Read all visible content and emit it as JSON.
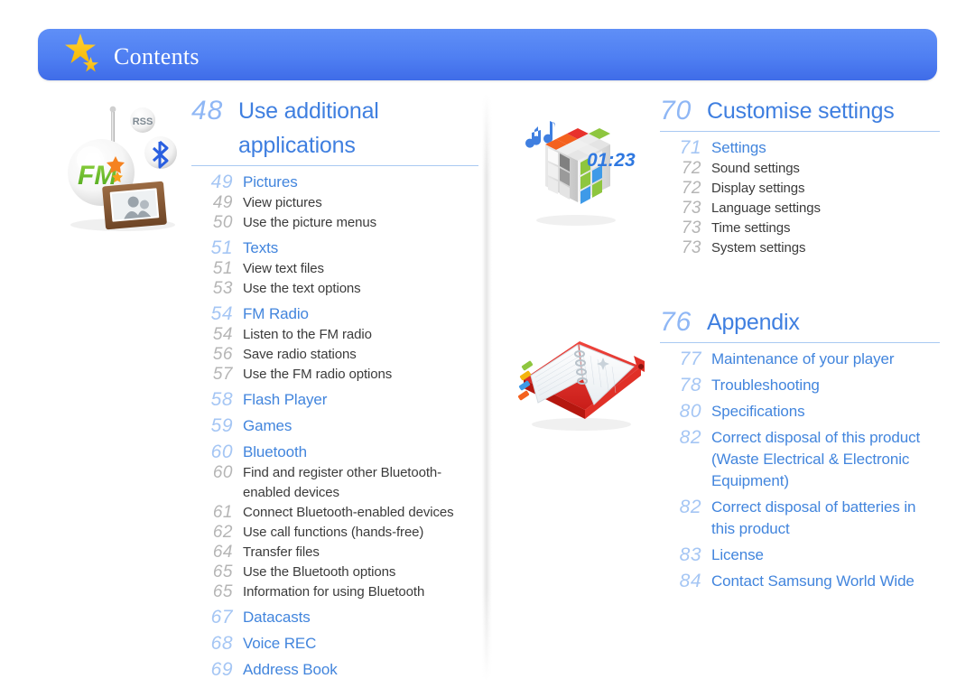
{
  "header": {
    "title": "Contents",
    "icon": "star-icon",
    "banner_color_top": "#5f8ff7",
    "banner_color_bottom": "#3f6ce8",
    "star_color": "#ffd23a"
  },
  "theme": {
    "major_text": "#4285dd",
    "major_number": "#a5c6f4",
    "sub_text": "#3b3b3b",
    "sub_number": "#b5b5b5",
    "section_title": "#3f7fe0",
    "section_number": "#8fb7f5",
    "rule": "#a9c9f2"
  },
  "left_column": {
    "illustration": {
      "name": "fm-radio-illustration",
      "fm_label": "FM",
      "rss_label": "RSS",
      "bluetooth_label": "bluetooth-icon"
    },
    "section": {
      "number": "48",
      "title": "Use additional applications"
    },
    "entries": [
      {
        "level": 1,
        "number": "49",
        "label": "Pictures"
      },
      {
        "level": 2,
        "number": "49",
        "label": "View pictures"
      },
      {
        "level": 2,
        "number": "50",
        "label": "Use the picture menus"
      },
      {
        "level": 1,
        "number": "51",
        "label": "Texts"
      },
      {
        "level": 2,
        "number": "51",
        "label": "View text files"
      },
      {
        "level": 2,
        "number": "53",
        "label": "Use the text options"
      },
      {
        "level": 1,
        "number": "54",
        "label": "FM Radio"
      },
      {
        "level": 2,
        "number": "54",
        "label": "Listen to the FM radio"
      },
      {
        "level": 2,
        "number": "56",
        "label": "Save radio stations"
      },
      {
        "level": 2,
        "number": "57",
        "label": "Use the FM radio options"
      },
      {
        "level": 1,
        "number": "58",
        "label": "Flash Player"
      },
      {
        "level": 1,
        "number": "59",
        "label": "Games"
      },
      {
        "level": 1,
        "number": "60",
        "label": "Bluetooth"
      },
      {
        "level": 2,
        "number": "60",
        "label": "Find and register other Bluetooth-enabled devices"
      },
      {
        "level": 2,
        "number": "61",
        "label": "Connect Bluetooth-enabled devices"
      },
      {
        "level": 2,
        "number": "62",
        "label": "Use call functions (hands-free)"
      },
      {
        "level": 2,
        "number": "64",
        "label": "Transfer files"
      },
      {
        "level": 2,
        "number": "65",
        "label": "Use the Bluetooth options"
      },
      {
        "level": 2,
        "number": "65",
        "label": "Information for using Bluetooth"
      },
      {
        "level": 1,
        "number": "67",
        "label": "Datacasts"
      },
      {
        "level": 1,
        "number": "68",
        "label": "Voice REC"
      },
      {
        "level": 1,
        "number": "69",
        "label": "Address Book"
      }
    ]
  },
  "right_column": {
    "settings_illustration": {
      "name": "rubiks-cube-illustration",
      "timer_label": "01:23",
      "music_note": "music-note-icon"
    },
    "settings_section": {
      "number": "70",
      "title": "Customise settings"
    },
    "settings_entries": [
      {
        "level": 1,
        "number": "71",
        "label": "Settings"
      },
      {
        "level": 2,
        "number": "72",
        "label": "Sound settings"
      },
      {
        "level": 2,
        "number": "72",
        "label": "Display settings"
      },
      {
        "level": 2,
        "number": "73",
        "label": "Language settings"
      },
      {
        "level": 2,
        "number": "73",
        "label": "Time settings"
      },
      {
        "level": 2,
        "number": "73",
        "label": "System settings"
      }
    ],
    "appendix_illustration": {
      "name": "red-organizer-illustration"
    },
    "appendix_section": {
      "number": "76",
      "title": "Appendix"
    },
    "appendix_entries": [
      {
        "level": 1,
        "number": "77",
        "label": "Maintenance of your player"
      },
      {
        "level": 1,
        "number": "78",
        "label": "Troubleshooting"
      },
      {
        "level": 1,
        "number": "80",
        "label": "Specifications"
      },
      {
        "level": 1,
        "number": "82",
        "label": "Correct disposal of this product (Waste Electrical & Electronic Equipment)"
      },
      {
        "level": 1,
        "number": "82",
        "label": "Correct disposal of batteries in this product"
      },
      {
        "level": 1,
        "number": "83",
        "label": "License"
      },
      {
        "level": 1,
        "number": "84",
        "label": "Contact Samsung World Wide"
      }
    ]
  }
}
